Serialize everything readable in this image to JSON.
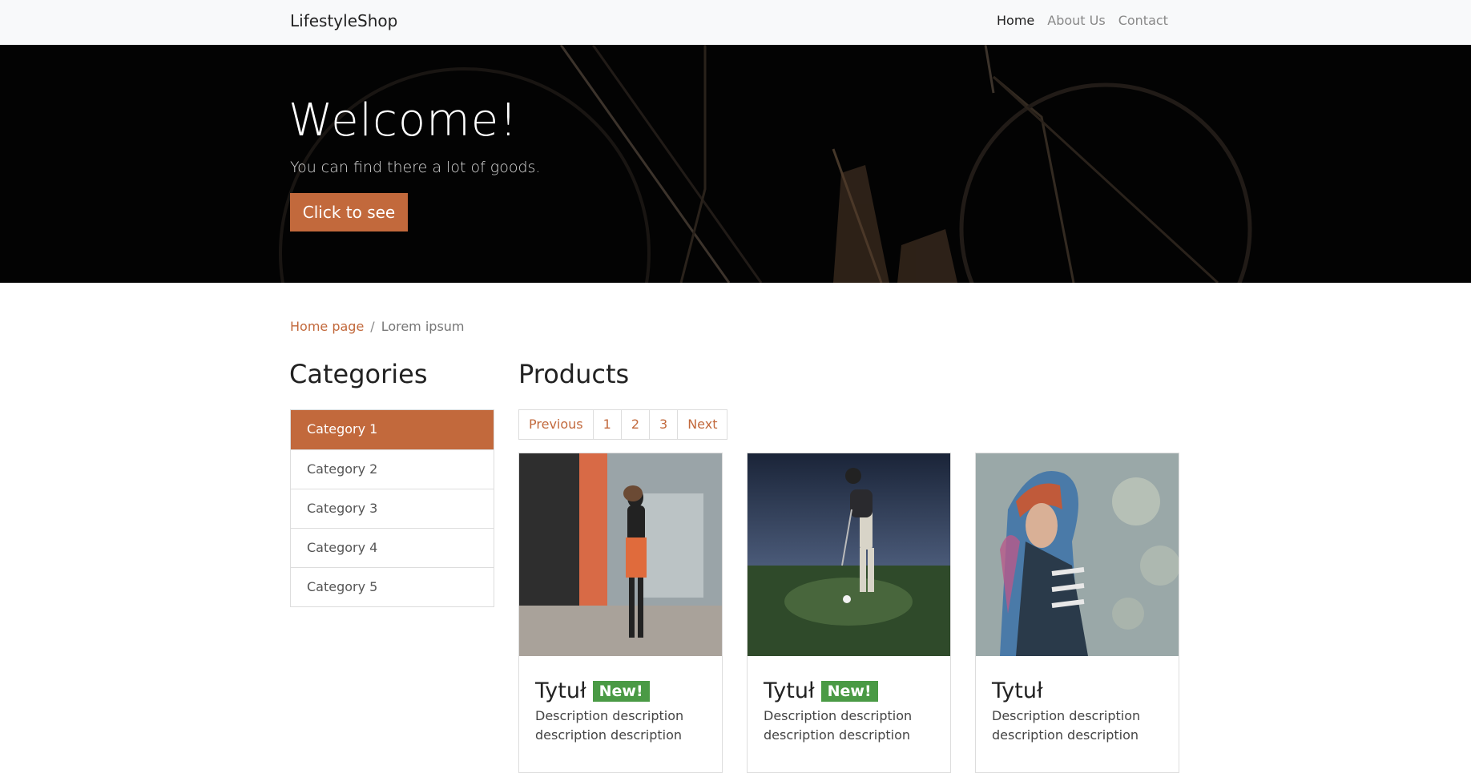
{
  "navbar": {
    "brand": "LifestyleShop",
    "links": [
      "Home",
      "About Us",
      "Contact"
    ],
    "active": "Home"
  },
  "hero": {
    "title": "Welcome!",
    "subtitle": "You can find there a lot of goods.",
    "button": "Click to see"
  },
  "breadcrumb": {
    "home": "Home page",
    "separator": "/",
    "current": "Lorem ipsum"
  },
  "categories": {
    "title": "Categories",
    "items": [
      "Category 1",
      "Category 2",
      "Category 3",
      "Category 4",
      "Category 5"
    ],
    "active_index": 0
  },
  "products": {
    "title": "Products",
    "pagination": [
      "Previous",
      "1",
      "2",
      "3",
      "Next"
    ],
    "items": [
      {
        "title": "Tytuł",
        "badge": "New!",
        "description": "Description description description description"
      },
      {
        "title": "Tytuł",
        "badge": "New!",
        "description": "Description description description description"
      },
      {
        "title": "Tytuł",
        "badge": "",
        "description": "Description description description description"
      }
    ]
  },
  "colors": {
    "accent": "#c2693c",
    "badge": "#4a9a45",
    "navbar_bg": "#f8f9fa",
    "hero_bg": "#050505"
  }
}
